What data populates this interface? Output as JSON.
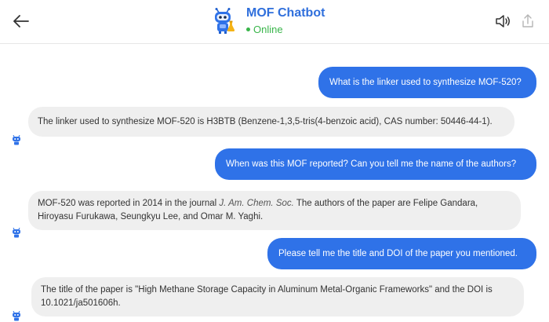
{
  "header": {
    "title": "MOF Chatbot",
    "status": "Online",
    "colors": {
      "title": "#2f6fdc",
      "status": "#39b54a"
    }
  },
  "icons": {
    "back": "arrow-left-icon",
    "avatar": "robot-icon",
    "speaker": "speaker-icon",
    "share": "share-icon"
  },
  "messages": [
    {
      "role": "user",
      "text": "What is the linker used to synthesize MOF-520?"
    },
    {
      "role": "bot",
      "text": "The linker used to synthesize MOF-520 is H3BTB (Benzene-1,3,5-tris(4-benzoic acid), CAS number: 50446-44-1)."
    },
    {
      "role": "user",
      "text": "When was this MOF reported? Can you tell me the name of the authors?"
    },
    {
      "role": "bot",
      "text_before": "MOF-520 was reported in 2014 in the journal ",
      "journal": "J. Am. Chem. Soc.",
      "text_after": " The authors of the paper are Felipe Gandara, Hiroyasu Furukawa, Seungkyu Lee, and Omar M. Yaghi."
    },
    {
      "role": "user",
      "text": "Please tell me the title and DOI of the paper you mentioned."
    },
    {
      "role": "bot",
      "text": "The title of the paper is \"High Methane Storage Capacity in Aluminum Metal-Organic Frameworks\" and the DOI is 10.1021/ja501606h."
    }
  ],
  "colors": {
    "user_bubble": "#2f72e8",
    "bot_bubble": "#efefef"
  }
}
